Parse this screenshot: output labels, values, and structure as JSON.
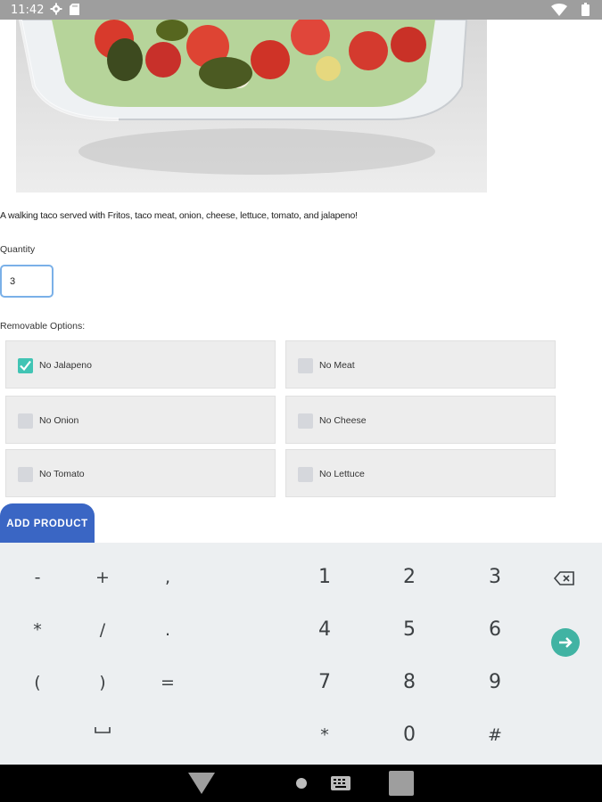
{
  "status_bar": {
    "time": "11:42",
    "icons": [
      "gear-icon",
      "sd-card-icon",
      "wifi-icon",
      "battery-icon"
    ]
  },
  "product": {
    "image": "walking-taco-photo",
    "description": "A walking taco served with Fritos, taco meat, onion, cheese, lettuce, tomato, and jalapeno!",
    "quantity_label": "Quantity",
    "quantity_value": "3",
    "removable_label": "Removable Options:",
    "options": [
      {
        "label": "No Jalapeno",
        "checked": true
      },
      {
        "label": "No Meat",
        "checked": false
      },
      {
        "label": "No Onion",
        "checked": false
      },
      {
        "label": "No Cheese",
        "checked": false
      },
      {
        "label": "No Tomato",
        "checked": false
      },
      {
        "label": "No Lettuce",
        "checked": false
      }
    ],
    "add_button": "ADD PRODUCT"
  },
  "keyboard": {
    "row1": [
      "-",
      "+",
      ",",
      "1",
      "2",
      "3"
    ],
    "row2": [
      "*",
      "/",
      ".",
      "4",
      "5",
      "6"
    ],
    "row3": [
      "(",
      ")",
      "=",
      "7",
      "8",
      "9"
    ],
    "row4": [
      "*",
      "0",
      "#"
    ],
    "special_icons": [
      "backspace-icon",
      "go-arrow-icon",
      "space-icon"
    ]
  },
  "colors": {
    "accent": "#3a66c4",
    "checkbox": "#41c4b4",
    "go_key": "#41b3a3"
  }
}
